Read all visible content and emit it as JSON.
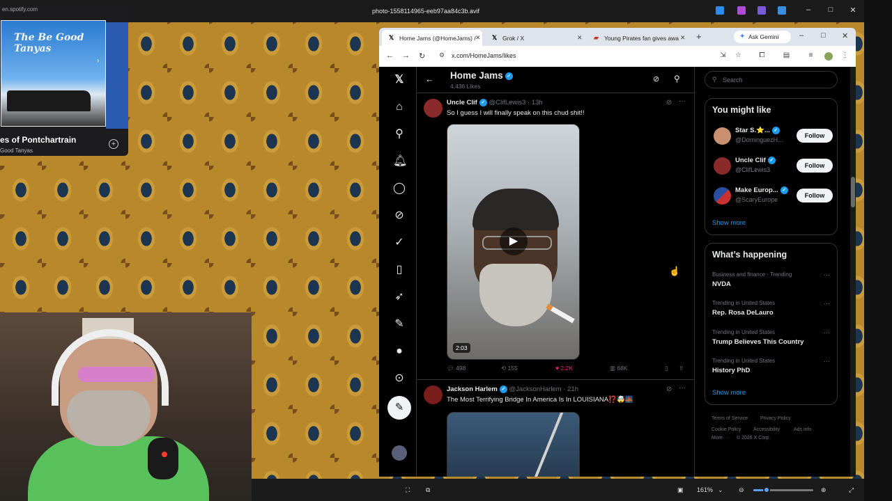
{
  "viewer": {
    "title": "photo-1558114965-eeb97aa84c3b.avif",
    "zoom": "161%",
    "zoom_level": 0.22
  },
  "spotify": {
    "url": "en.spotify.com",
    "art_title": "The Be Good Tanyas",
    "song": "es of Pontchartrain",
    "artist": "Good Tanyas"
  },
  "browser": {
    "tabs": [
      {
        "label": "Home Jams (@HomeJams) /",
        "icon": "x-logo"
      },
      {
        "label": "Grok / X",
        "icon": "x-logo"
      },
      {
        "label": "Young Pirates fan gives awa",
        "icon": "mlb-logo"
      }
    ],
    "gemini_label": "Ask Gemini",
    "url": "x.com/HomeJams/likes"
  },
  "x": {
    "header": {
      "name": "Home Jams",
      "likes": "4,436 Likes"
    },
    "tweets": [
      {
        "name": "Uncle Clif",
        "handle": "@ClifLewis3 · 13h",
        "text": "So I guess I will finally speak on this chud shit!!",
        "video_duration": "2:03",
        "replies": "498",
        "reposts": "155",
        "likes": "2.2K",
        "views": "68K"
      },
      {
        "name": "Jackson Harlem",
        "handle": "@JacksonHarlem · 21h",
        "text": "The Most Terrifying Bridge In America Is In LOUISIANA⁉️🤯🌉"
      }
    ],
    "sidebar": {
      "search_placeholder": "Search",
      "wtf_title": "You might like",
      "wtf": [
        {
          "name": "Star S.⭐️...",
          "handle": "@DominguezH...",
          "follow": "Follow"
        },
        {
          "name": "Uncle Clif",
          "handle": "@ClifLewis3",
          "follow": "Follow"
        },
        {
          "name": "Make Europ...",
          "handle": "@ScaryEurope",
          "follow": "Follow"
        }
      ],
      "wtf_show_more": "Show more",
      "happening_title": "What’s happening",
      "trends": [
        {
          "context": "Business and finance · Trending",
          "name": "NVDA"
        },
        {
          "context": "Trending in United States",
          "name": "Rep. Rosa DeLauro"
        },
        {
          "context": "Trending in United States",
          "name": "Trump Believes This Country"
        },
        {
          "context": "Trending in United States",
          "name": "History PhD"
        }
      ],
      "happening_show_more": "Show more",
      "footer": {
        "terms": "Terms of Service",
        "privacy": "Privacy Policy",
        "cookie": "Cookie Policy",
        "accessibility": "Accessibility",
        "ads": "Ads info",
        "more": "More ···",
        "copyright": "© 2026 X Corp."
      }
    }
  },
  "colors": {
    "x_blue": "#1d9bf0",
    "like_pink": "#f91880",
    "x_background": "#000000"
  }
}
